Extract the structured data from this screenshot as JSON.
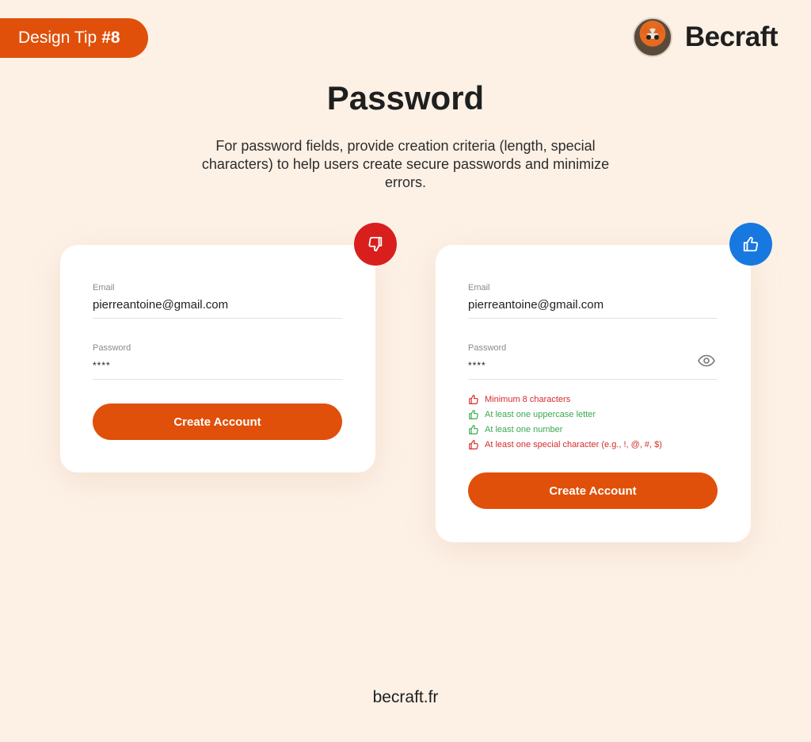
{
  "header": {
    "tip_label": "Design Tip",
    "tip_number": "#8",
    "brand_name": "Becraft",
    "avatar_icon": "fox-avatar"
  },
  "title": "Password",
  "subtitle": "For password fields, provide creation criteria (length, special characters) to help users create secure passwords and minimize errors.",
  "bad_example": {
    "verdict_icon": "thumbs-down-icon",
    "verdict_color": "#d91e1e",
    "email_label": "Email",
    "email_value": "pierreantoine@gmail.com",
    "password_label": "Password",
    "password_value": "****",
    "button_label": "Create Account"
  },
  "good_example": {
    "verdict_icon": "thumbs-up-icon",
    "verdict_color": "#1778e0",
    "email_label": "Email",
    "email_value": "pierreantoine@gmail.com",
    "password_label": "Password",
    "password_value": "****",
    "show_password_icon": "eye-icon",
    "criteria": [
      {
        "text": "Minimum 8 characters",
        "status": "fail"
      },
      {
        "text": "At least one uppercase letter",
        "status": "pass"
      },
      {
        "text": "At least one number",
        "status": "pass"
      },
      {
        "text": "At least one special character (e.g., !, @, #, $)",
        "status": "fail"
      }
    ],
    "button_label": "Create Account"
  },
  "colors": {
    "accent": "#e0500a",
    "background": "#fdf1e6",
    "fail": "#d62b2b",
    "pass": "#3aa84f"
  },
  "footer": "becraft.fr"
}
